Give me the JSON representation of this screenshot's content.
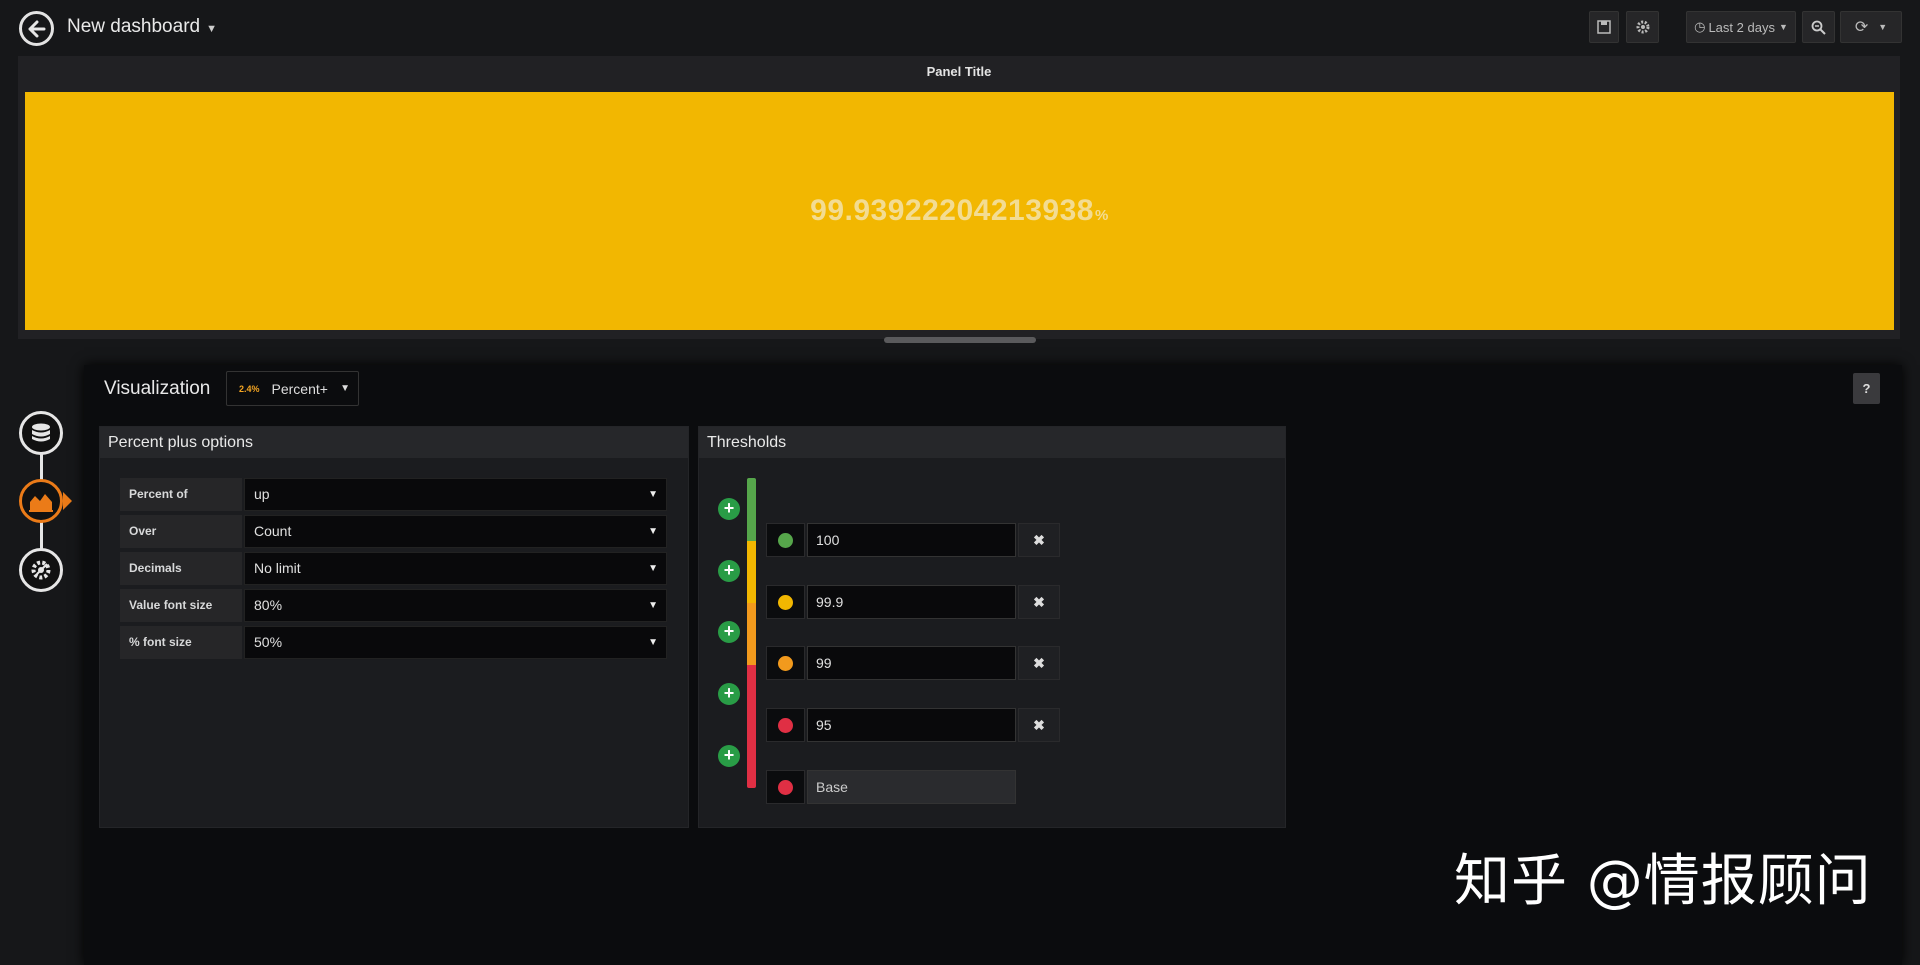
{
  "header": {
    "title": "New dashboard",
    "time_range": "Last 2 days"
  },
  "panel": {
    "title": "Panel Title",
    "value": "99.93922204213938",
    "unit": "%",
    "background_color": "#f2b701"
  },
  "editor": {
    "visualization_label": "Visualization",
    "visualization_icon_text": "2.4%",
    "visualization_name": "Percent+",
    "help_label": "?"
  },
  "options": {
    "title": "Percent plus options",
    "rows": [
      {
        "label": "Percent of",
        "value": "up"
      },
      {
        "label": "Over",
        "value": "Count"
      },
      {
        "label": "Decimals",
        "value": "No limit"
      },
      {
        "label": "Value font size",
        "value": "80%"
      },
      {
        "label": "% font size",
        "value": "50%"
      }
    ]
  },
  "thresholds": {
    "title": "Thresholds",
    "items": [
      {
        "value": "100",
        "color": "#56a64b"
      },
      {
        "value": "99.9",
        "color": "#f2b701"
      },
      {
        "value": "99",
        "color": "#f29a1d"
      },
      {
        "value": "95",
        "color": "#e02f44"
      },
      {
        "value": "Base",
        "color": "#e02f44"
      }
    ]
  },
  "watermark": "知乎 @情报顾问"
}
